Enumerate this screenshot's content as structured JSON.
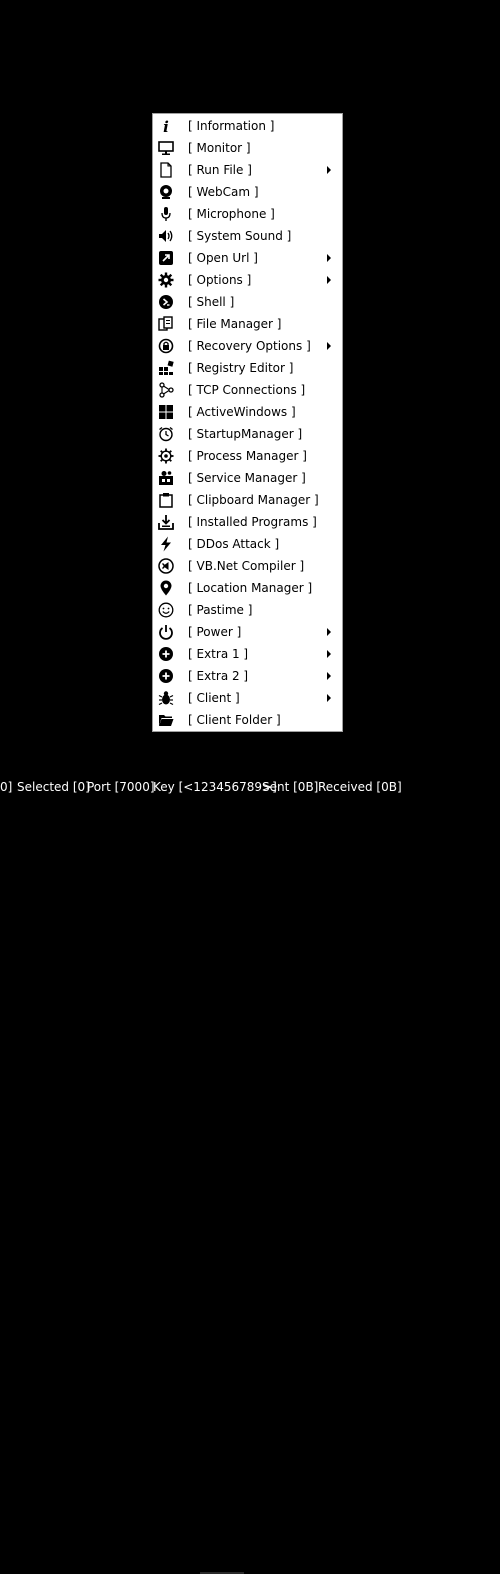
{
  "menu": {
    "items": [
      {
        "label": "[ Information ]",
        "icon": "info-icon",
        "submenu": false
      },
      {
        "label": "[ Monitor ]",
        "icon": "monitor-icon",
        "submenu": false
      },
      {
        "label": "[ Run File ]",
        "icon": "file-icon",
        "submenu": true
      },
      {
        "label": "[ WebCam ]",
        "icon": "webcam-icon",
        "submenu": false
      },
      {
        "label": "[ Microphone ]",
        "icon": "microphone-icon",
        "submenu": false
      },
      {
        "label": "[ System Sound ]",
        "icon": "speaker-icon",
        "submenu": false
      },
      {
        "label": "[ Open Url ]",
        "icon": "external-link-icon",
        "submenu": true
      },
      {
        "label": "[ Options ]",
        "icon": "gear-icon",
        "submenu": true
      },
      {
        "label": "[ Shell ]",
        "icon": "terminal-icon",
        "submenu": false
      },
      {
        "label": "[ File Manager ]",
        "icon": "copy-files-icon",
        "submenu": false
      },
      {
        "label": "[ Recovery Options ]",
        "icon": "lock-recovery-icon",
        "submenu": true
      },
      {
        "label": "[ Registry Editor ]",
        "icon": "registry-icon",
        "submenu": false
      },
      {
        "label": "[ TCP Connections ]",
        "icon": "network-icon",
        "submenu": false
      },
      {
        "label": "[ ActiveWindows ]",
        "icon": "windows-logo-icon",
        "submenu": false
      },
      {
        "label": "[ StartupManager ]",
        "icon": "clock-icon",
        "submenu": false
      },
      {
        "label": "[ Process Manager ]",
        "icon": "cog-outline-icon",
        "submenu": false
      },
      {
        "label": "[ Service Manager ]",
        "icon": "service-icon",
        "submenu": false
      },
      {
        "label": "[ Clipboard Manager ]",
        "icon": "clipboard-icon",
        "submenu": false
      },
      {
        "label": "[ Installed Programs ]",
        "icon": "download-tray-icon",
        "submenu": false
      },
      {
        "label": "[ DDos Attack ]",
        "icon": "lightning-icon",
        "submenu": false
      },
      {
        "label": "[ VB.Net Compiler ]",
        "icon": "visual-studio-icon",
        "submenu": false
      },
      {
        "label": "[ Location Manager ]",
        "icon": "location-pin-icon",
        "submenu": false
      },
      {
        "label": "[ Pastime ]",
        "icon": "smiley-icon",
        "submenu": false
      },
      {
        "label": "[ Power ]",
        "icon": "power-icon",
        "submenu": true
      },
      {
        "label": "[ Extra 1 ]",
        "icon": "plus-circle-icon",
        "submenu": true
      },
      {
        "label": "[ Extra 2 ]",
        "icon": "plus-circle-icon",
        "submenu": true
      },
      {
        "label": "[ Client ]",
        "icon": "bug-icon",
        "submenu": true
      },
      {
        "label": "[ Client Folder ]",
        "icon": "folder-open-icon",
        "submenu": false
      }
    ]
  },
  "status_bar": {
    "online": "0]",
    "selected": "Selected [0]",
    "port": "Port [7000]",
    "key": "Key [<123456789>]",
    "sent": "Sent [0B]",
    "received": "Received [0B]"
  }
}
